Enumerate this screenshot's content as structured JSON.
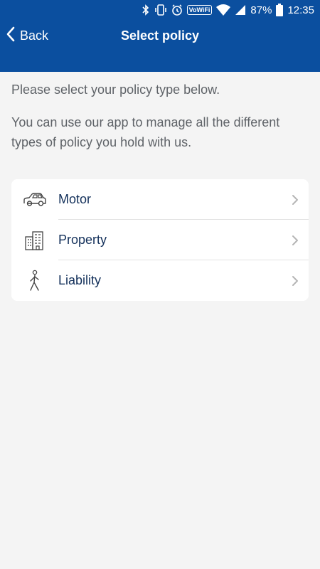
{
  "status_bar": {
    "wifi_badge": "VoWiFi",
    "battery": "87%",
    "time": "12:35"
  },
  "toolbar": {
    "back_label": "Back",
    "title": "Select policy"
  },
  "intro": {
    "line1": "Please select your policy type below.",
    "line2": "You can use our app to manage all the different types of policy you hold with us."
  },
  "policies": [
    {
      "label": "Motor",
      "icon": "car-icon"
    },
    {
      "label": "Property",
      "icon": "building-icon"
    },
    {
      "label": "Liability",
      "icon": "walking-person-icon"
    }
  ],
  "colors": {
    "header": "#0b4f9f",
    "background": "#f4f4f4",
    "label": "#13305a"
  }
}
